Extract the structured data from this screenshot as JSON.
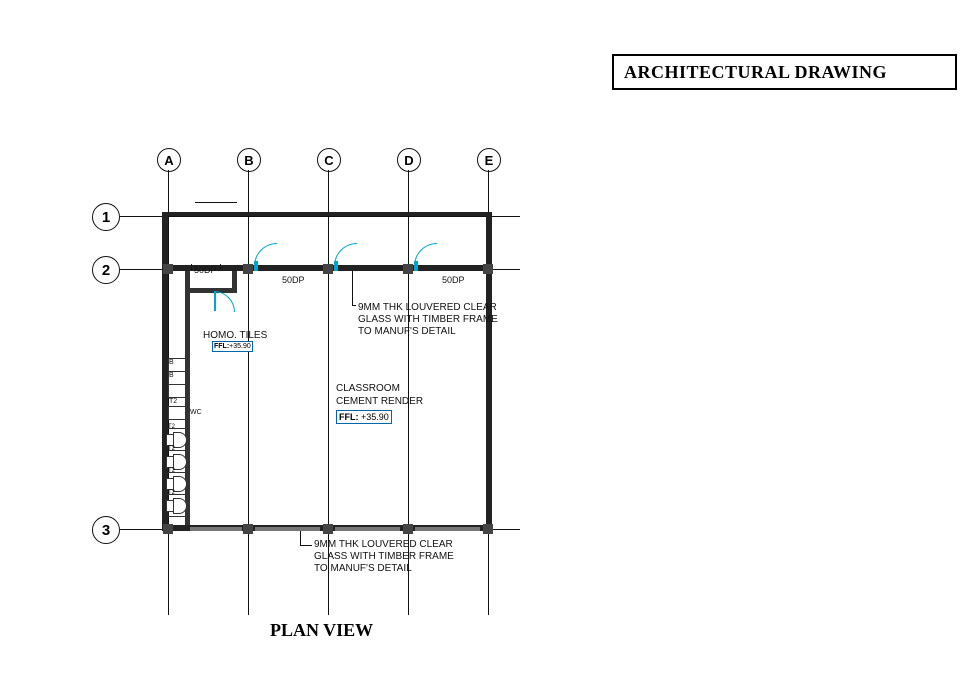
{
  "title": "ARCHITECTURAL DRAWING",
  "plan_label": "PLAN VIEW",
  "grid": {
    "cols": [
      "A",
      "B",
      "C",
      "D",
      "E"
    ],
    "rows": [
      "1",
      "2",
      "3"
    ]
  },
  "dims": {
    "dp1": "50DP",
    "dp2": "50DP",
    "dp3": "50DP"
  },
  "rooms": {
    "classroom": {
      "name": "CLASSROOM",
      "finish": "CEMENT RENDER",
      "ffl_label": "FFL:",
      "ffl_value": "+35.90"
    },
    "corridor": {
      "finish_label": "HOMO. TILES",
      "ffl_prefix": "FFL:",
      "ffl_value": "+35.90"
    },
    "wc": {
      "label": "WC",
      "stall_prefix": "B",
      "tag": "T2"
    }
  },
  "notes": {
    "louvre_top": {
      "l1": "9MM THK LOUVERED CLEAR",
      "l2": "GLASS WITH TIMBER FRAME",
      "l3": "TO MANUF'S DETAIL"
    },
    "louvre_bottom": {
      "l1": "9MM THK LOUVERED CLEAR",
      "l2": "GLASS WITH TIMBER FRAME",
      "l3": "TO MANUF'S DETAIL"
    }
  }
}
